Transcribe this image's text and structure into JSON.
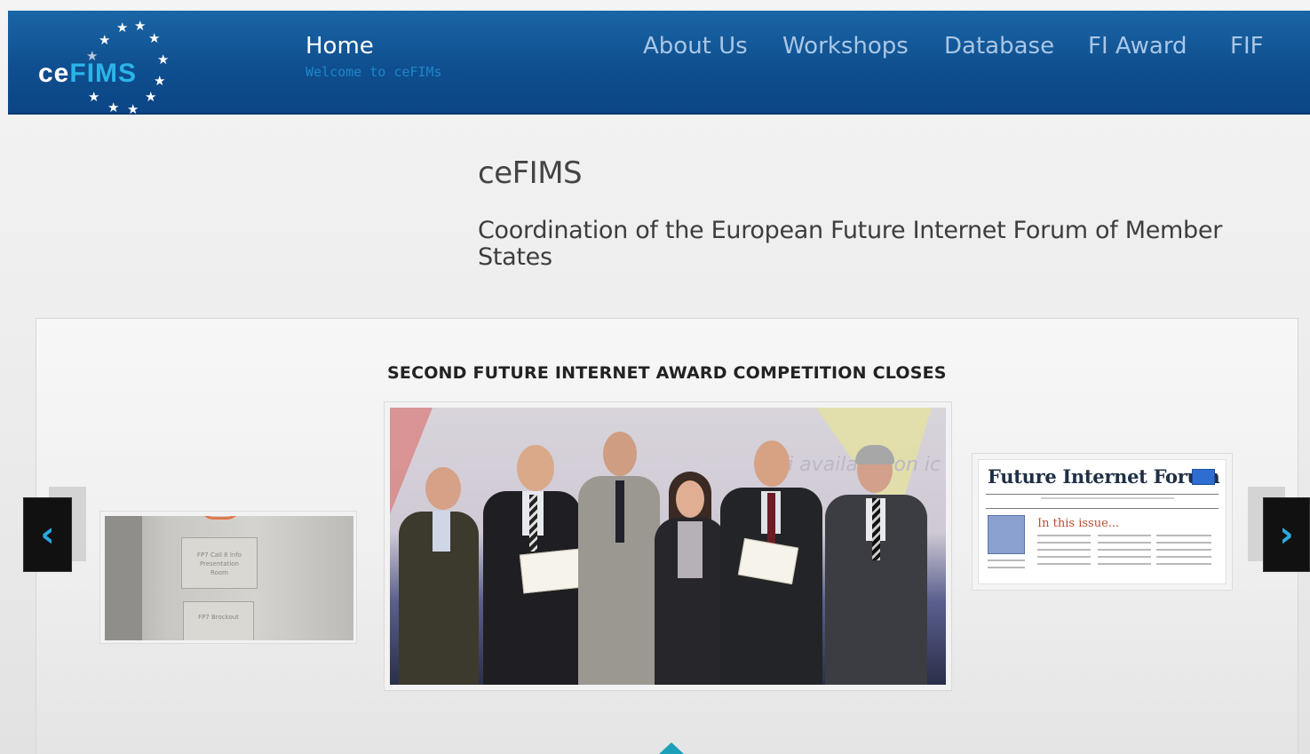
{
  "header": {
    "logo": {
      "prefix": "ce",
      "suffix": "FIMS"
    },
    "nav": {
      "home": {
        "label": "Home",
        "sub": "Welcome to ceFIMs"
      },
      "items": [
        {
          "label": "About Us"
        },
        {
          "label": "Workshops"
        },
        {
          "label": "Database"
        },
        {
          "label": "FI Award"
        },
        {
          "label": "FIF"
        }
      ]
    }
  },
  "intro": {
    "title": "ceFIMS",
    "subtitle": "Coordination of the European Future Internet Forum of Member States"
  },
  "slider": {
    "active_title": "SECOND FUTURE INTERNET AWARD COMPETITION CLOSES",
    "main_photo_caption": "fi available on ic",
    "left_thumb": {
      "sign_text": "FP7 Call 8 Info\nPresentation\nRoom",
      "sign2_text": "FP7 Brockout"
    },
    "right_thumb": {
      "title": "Future Internet Forum",
      "section": "In this issue..."
    },
    "prev_label": "‹",
    "next_label": "›"
  },
  "colors": {
    "header_blue": "#0f4f8f",
    "accent_cyan": "#29a9e1",
    "nav_inactive": "#a9c6e6"
  }
}
